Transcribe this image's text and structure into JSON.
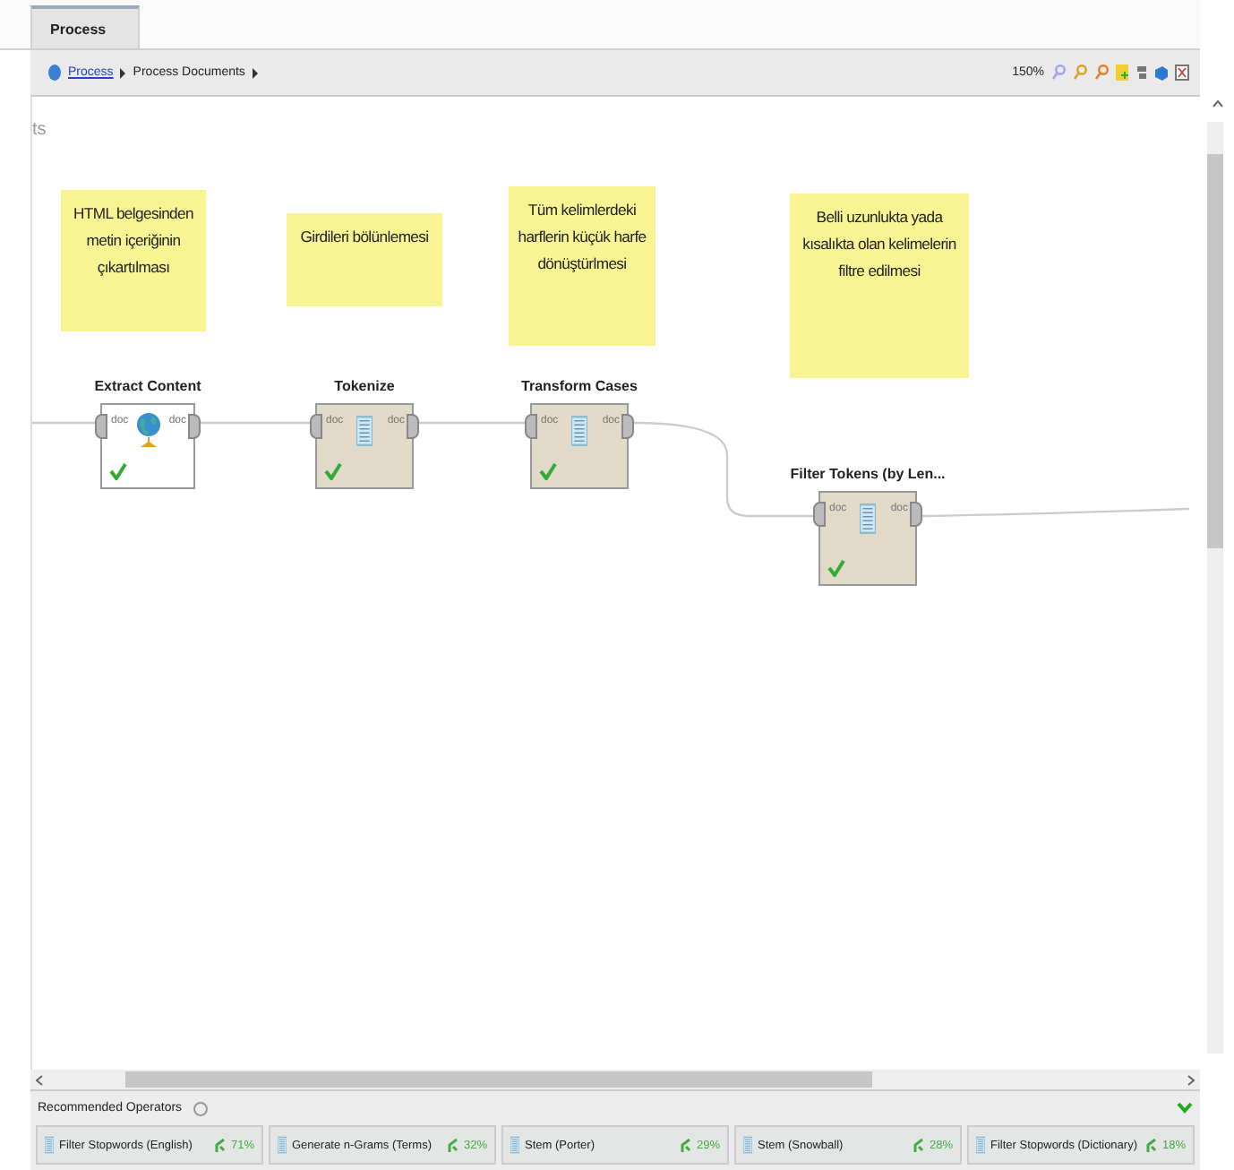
{
  "tabs": [
    {
      "label": "Process",
      "selected": true
    }
  ],
  "breadcrumb": {
    "root": "Process",
    "path": "Process Documents"
  },
  "toolbar": {
    "zoom": "150%"
  },
  "canvas": {
    "edge_text": "ts",
    "notes": [
      {
        "text": "HTML belgesinden metin içeriğinin çıkartılması"
      },
      {
        "text": "Girdileri bölünlemesi"
      },
      {
        "text": "Tüm kelimlerdeki harflerin küçük harfe dönüştürlmesi"
      },
      {
        "text": "Belli uzunlukta yada kısalıkta olan kelimelerin filtre edilmesi"
      }
    ],
    "operators": [
      {
        "name": "Extract Content",
        "kind": "web",
        "in_port": "doc",
        "out_port": "doc",
        "checked": true
      },
      {
        "name": "Tokenize",
        "kind": "text",
        "in_port": "doc",
        "out_port": "doc",
        "checked": true
      },
      {
        "name": "Transform Cases",
        "kind": "text",
        "in_port": "doc",
        "out_port": "doc",
        "checked": true
      },
      {
        "name": "Filter Tokens (by Len...",
        "kind": "text",
        "in_port": "doc",
        "out_port": "doc",
        "checked": true
      }
    ]
  },
  "recommended": {
    "title": "Recommended Operators",
    "items": [
      {
        "name": "Filter Stopwords (English)",
        "percent": "71%"
      },
      {
        "name": "Generate n-Grams (Terms)",
        "percent": "32%"
      },
      {
        "name": "Stem (Porter)",
        "percent": "29%"
      },
      {
        "name": "Stem (Snowball)",
        "percent": "28%"
      },
      {
        "name": "Filter Stopwords (Dictionary)",
        "percent": "18%"
      }
    ]
  }
}
